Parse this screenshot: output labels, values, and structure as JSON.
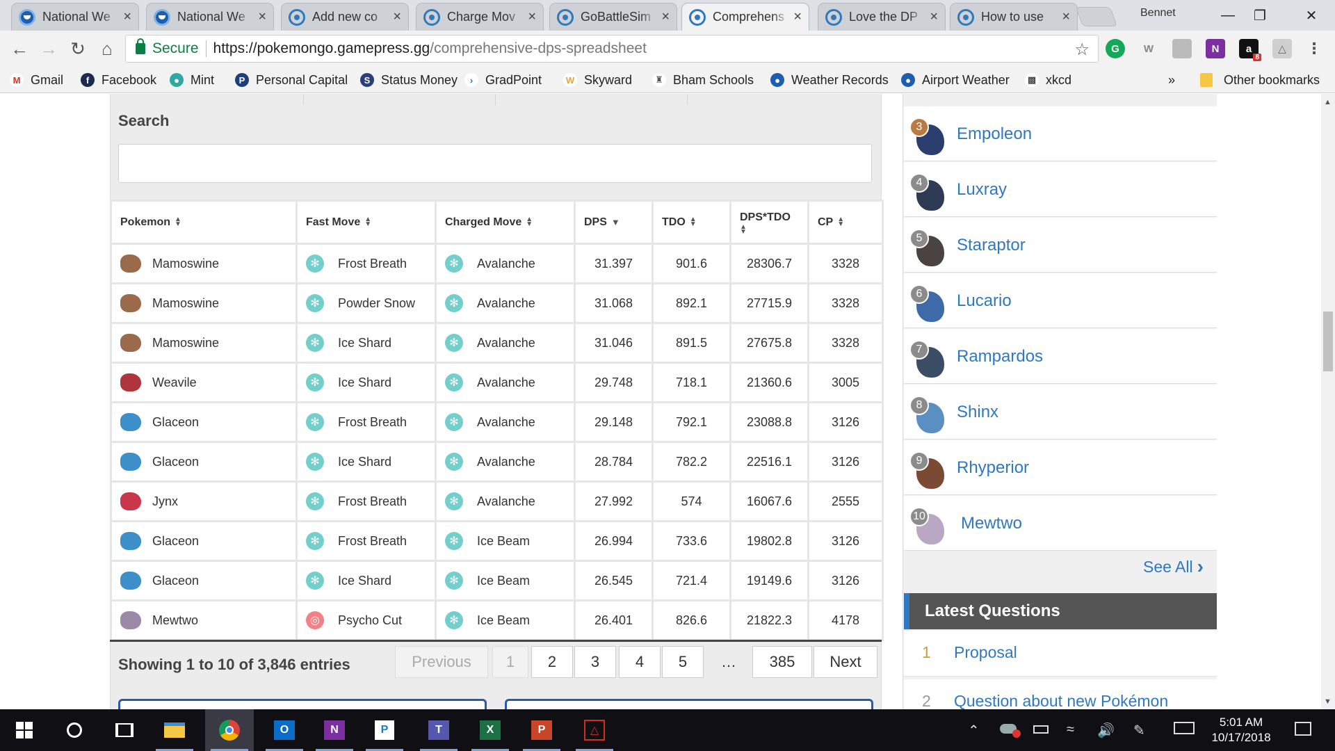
{
  "browser": {
    "tabs": [
      {
        "title": "National We",
        "icon": "noaa-icon"
      },
      {
        "title": "National We",
        "icon": "noaa-icon"
      },
      {
        "title": "Add new co",
        "icon": "gamepress-icon"
      },
      {
        "title": "Charge Mov",
        "icon": "gamepress-icon"
      },
      {
        "title": "GoBattleSim",
        "icon": "gamepress-icon"
      },
      {
        "title": "Comprehens",
        "icon": "gamepress-icon"
      },
      {
        "title": "Love the DP",
        "icon": "gamepress-icon"
      },
      {
        "title": "How to use",
        "icon": "gamepress-icon"
      }
    ],
    "profile_name": "Bennet",
    "url_secure_label": "Secure",
    "url_host": "https://pokemongo.gamepress.gg",
    "url_path": "/comprehensive-dps-spreadsheet",
    "bookmarks": [
      "Gmail",
      "Facebook",
      "Mint",
      "Personal Capital",
      "Status Money",
      "GradPoint",
      "Skyward",
      "Bham Schools",
      "Weather Records",
      "Airport Weather",
      "xkcd"
    ],
    "overflow_label": "»",
    "other_bookmarks": "Other bookmarks",
    "ext_badge": "8"
  },
  "search": {
    "label": "Search",
    "value": ""
  },
  "table": {
    "headers": [
      "Pokemon",
      "Fast Move",
      "Charged Move",
      "DPS",
      "TDO",
      "DPS*TDO",
      "CP"
    ],
    "rows": [
      {
        "pokemon": "Mamoswine",
        "fast": "Frost Breath",
        "fast_type": "ice",
        "charged": "Avalanche",
        "dps": "31.397",
        "tdo": "901.6",
        "dpstdo": "28306.7",
        "cp": "3328"
      },
      {
        "pokemon": "Mamoswine",
        "fast": "Powder Snow",
        "fast_type": "ice",
        "charged": "Avalanche",
        "dps": "31.068",
        "tdo": "892.1",
        "dpstdo": "27715.9",
        "cp": "3328"
      },
      {
        "pokemon": "Mamoswine",
        "fast": "Ice Shard",
        "fast_type": "ice",
        "charged": "Avalanche",
        "dps": "31.046",
        "tdo": "891.5",
        "dpstdo": "27675.8",
        "cp": "3328"
      },
      {
        "pokemon": "Weavile",
        "fast": "Ice Shard",
        "fast_type": "ice",
        "charged": "Avalanche",
        "dps": "29.748",
        "tdo": "718.1",
        "dpstdo": "21360.6",
        "cp": "3005"
      },
      {
        "pokemon": "Glaceon",
        "fast": "Frost Breath",
        "fast_type": "ice",
        "charged": "Avalanche",
        "dps": "29.148",
        "tdo": "792.1",
        "dpstdo": "23088.8",
        "cp": "3126"
      },
      {
        "pokemon": "Glaceon",
        "fast": "Ice Shard",
        "fast_type": "ice",
        "charged": "Avalanche",
        "dps": "28.784",
        "tdo": "782.2",
        "dpstdo": "22516.1",
        "cp": "3126"
      },
      {
        "pokemon": "Jynx",
        "fast": "Frost Breath",
        "fast_type": "ice",
        "charged": "Avalanche",
        "dps": "27.992",
        "tdo": "574",
        "dpstdo": "16067.6",
        "cp": "2555"
      },
      {
        "pokemon": "Glaceon",
        "fast": "Frost Breath",
        "fast_type": "ice",
        "charged": "Ice Beam",
        "dps": "26.994",
        "tdo": "733.6",
        "dpstdo": "19802.8",
        "cp": "3126"
      },
      {
        "pokemon": "Glaceon",
        "fast": "Ice Shard",
        "fast_type": "ice",
        "charged": "Ice Beam",
        "dps": "26.545",
        "tdo": "721.4",
        "dpstdo": "19149.6",
        "cp": "3126"
      },
      {
        "pokemon": "Mewtwo",
        "fast": "Psycho Cut",
        "fast_type": "psychic",
        "charged": "Ice Beam",
        "dps": "26.401",
        "tdo": "826.6",
        "dpstdo": "21822.3",
        "cp": "4178"
      }
    ]
  },
  "pagination": {
    "info": "Showing 1 to 10 of 3,846 entries",
    "previous": "Previous",
    "pages": [
      "1",
      "2",
      "3",
      "4",
      "5"
    ],
    "ellipsis": "…",
    "last": "385",
    "next": "Next"
  },
  "rankings": [
    {
      "rank": "3",
      "name": "Empoleon",
      "color": "#2b3f6e"
    },
    {
      "rank": "4",
      "name": "Luxray",
      "color": "#2f3a55"
    },
    {
      "rank": "5",
      "name": "Staraptor",
      "color": "#4a4340"
    },
    {
      "rank": "6",
      "name": "Lucario",
      "color": "#3f6aa8"
    },
    {
      "rank": "7",
      "name": "Rampardos",
      "color": "#3c4d66"
    },
    {
      "rank": "8",
      "name": "Shinx",
      "color": "#5a8fc2"
    },
    {
      "rank": "9",
      "name": "Rhyperior",
      "color": "#7a4a35"
    },
    {
      "rank": "10",
      "name": "Mewtwo",
      "color": "#b9a7c4"
    }
  ],
  "see_all": "See All",
  "latest_questions": {
    "title": "Latest Questions",
    "items": [
      {
        "n": "1",
        "text": "Proposal"
      },
      {
        "n": "2",
        "text": "Question about new Pokémon"
      }
    ]
  },
  "taskbar": {
    "time": "5:01 AM",
    "date": "10/17/2018"
  }
}
